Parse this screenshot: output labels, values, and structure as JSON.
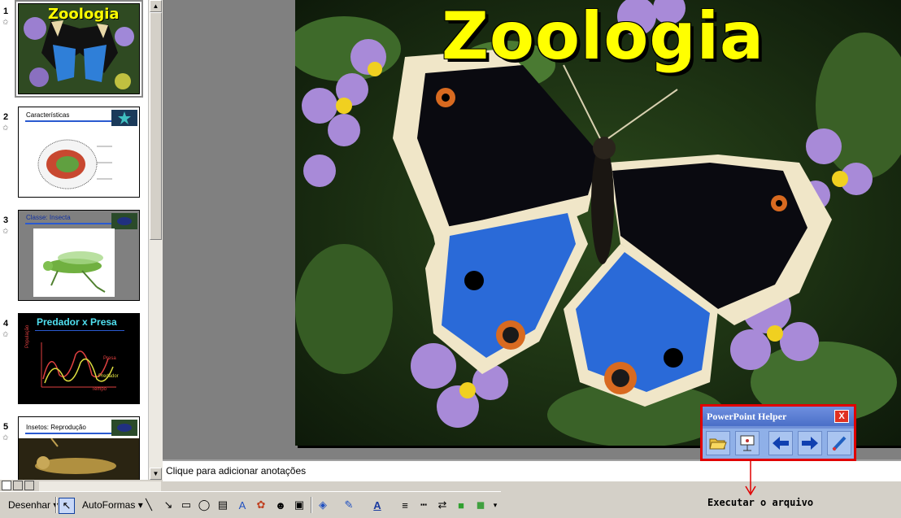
{
  "slides": [
    {
      "number": "1",
      "title": "Zoologia"
    },
    {
      "number": "2",
      "title": "Características"
    },
    {
      "number": "3",
      "title": "Classe: Insecta"
    },
    {
      "number": "4",
      "title": "Predador x Presa",
      "chart_labels": {
        "ylabel": "População",
        "xlabel": "Tempo",
        "presa": "Presa",
        "predador": "Predador"
      }
    },
    {
      "number": "5",
      "title": "Insetos: Reprodução"
    }
  ],
  "slide_star": "✩",
  "current_slide": {
    "title": "Zoologia",
    "title_color": "#ffff00"
  },
  "notes": {
    "placeholder": "Clique para adicionar anotações"
  },
  "toolbar": {
    "draw_label": "Desenhar",
    "autoshapes_label": "AutoFormas"
  },
  "helper": {
    "title": "PowerPoint Helper",
    "close": "X"
  },
  "annotation": {
    "label": "Executar o arquivo"
  },
  "colors": {
    "panel_bg": "#ffffff",
    "editor_bg": "#808080",
    "helper_border": "#e00000"
  }
}
